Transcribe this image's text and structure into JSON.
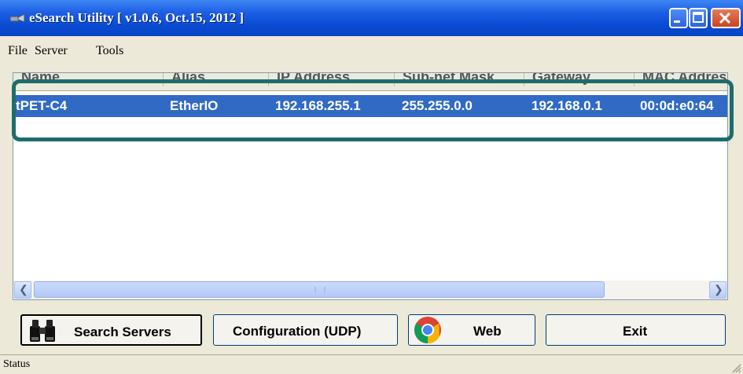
{
  "window": {
    "title": "eSearch Utility [ v1.0.6, Oct.15, 2012 ]",
    "controls": [
      "minimize-icon",
      "maximize-icon",
      "close-icon"
    ]
  },
  "menu": [
    "File",
    "Server",
    "Tools"
  ],
  "table": {
    "columns": [
      "Name",
      "Alias",
      "IP Address",
      "Sub-net Mask",
      "Gateway",
      "MAC Addres"
    ],
    "rows": [
      {
        "name": "tPET-C4",
        "alias": "EtherIO",
        "ip": "192.168.255.1",
        "subnet": "255.255.0.0",
        "gateway": "192.168.0.1",
        "mac": "00:0d:e0:64"
      }
    ],
    "selected_row_color": "#316AC5",
    "highlight_color": "#1E6C6C"
  },
  "buttons": {
    "search": "Search Servers",
    "config": "Configuration (UDP)",
    "web": "Web",
    "exit": "Exit"
  },
  "status": "Status",
  "colors": {
    "titlebar": "#0A4BD3",
    "face": "#ECE9D8"
  }
}
